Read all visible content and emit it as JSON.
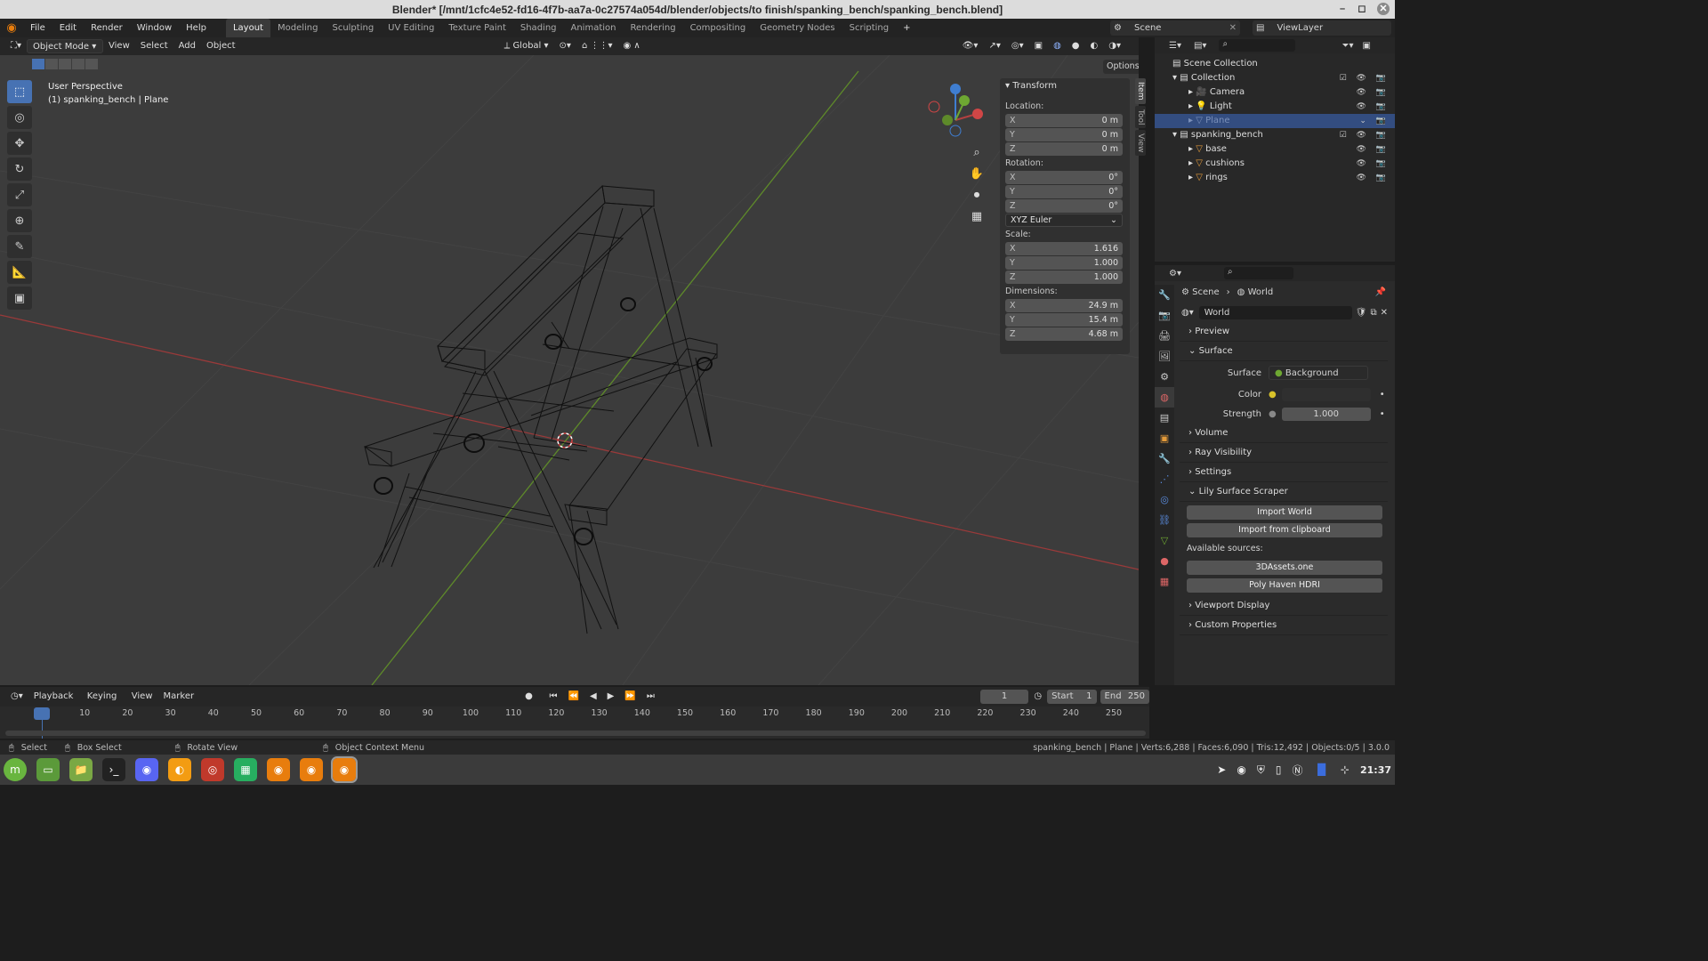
{
  "window": {
    "title": "Blender* [/mnt/1cfc4e52-fd16-4f7b-aa7a-0c27574a054d/blender/objects/to finish/spanking_bench/spanking_bench.blend]"
  },
  "menus": [
    "File",
    "Edit",
    "Render",
    "Window",
    "Help"
  ],
  "workspaces": [
    "Layout",
    "Modeling",
    "Sculpting",
    "UV Editing",
    "Texture Paint",
    "Shading",
    "Animation",
    "Rendering",
    "Compositing",
    "Geometry Nodes",
    "Scripting"
  ],
  "scene": {
    "name": "Scene",
    "view_layer": "ViewLayer"
  },
  "header3d": {
    "mode": "Object Mode",
    "view": "View",
    "select": "Select",
    "add": "Add",
    "object": "Object",
    "orientation": "Global",
    "options": "Options"
  },
  "viewport": {
    "perspective": "User Perspective",
    "selection": "(1) spanking_bench | Plane"
  },
  "npanel": {
    "section": "Transform",
    "location_label": "Location:",
    "location": {
      "x": "0 m",
      "y": "0 m",
      "z": "0 m"
    },
    "rotation_label": "Rotation:",
    "rotation": {
      "x": "0°",
      "y": "0°",
      "z": "0°"
    },
    "rotation_mode": "XYZ Euler",
    "scale_label": "Scale:",
    "scale": {
      "x": "1.616",
      "y": "1.000",
      "z": "1.000"
    },
    "dimensions_label": "Dimensions:",
    "dimensions": {
      "x": "24.9 m",
      "y": "15.4 m",
      "z": "4.68 m"
    },
    "tabs": [
      "Item",
      "Tool",
      "View"
    ]
  },
  "outliner": {
    "root": "Scene Collection",
    "rows": [
      {
        "label": "Collection"
      },
      {
        "label": "Camera"
      },
      {
        "label": "Light"
      },
      {
        "label": "Plane"
      },
      {
        "label": "spanking_bench"
      },
      {
        "label": "base"
      },
      {
        "label": "cushions"
      },
      {
        "label": "rings"
      }
    ]
  },
  "properties": {
    "breadcrumb_scene": "Scene",
    "breadcrumb_world": "World",
    "world_name": "World",
    "sections": {
      "preview": "Preview",
      "surface": "Surface",
      "volume": "Volume",
      "ray_visibility": "Ray Visibility",
      "settings": "Settings",
      "lily": "Lily Surface Scraper",
      "viewport_display": "Viewport Display",
      "custom_properties": "Custom Properties"
    },
    "surface_label": "Surface",
    "surface_value": "Background",
    "color_label": "Color",
    "strength_label": "Strength",
    "strength_value": "1.000",
    "import_world": "Import World",
    "import_clipboard": "Import from clipboard",
    "available_sources": "Available sources:",
    "source_1": "3DAssets.one",
    "source_2": "Poly Haven HDRI"
  },
  "timeline": {
    "playback": "Playback",
    "keying": "Keying",
    "view": "View",
    "marker": "Marker",
    "current_frame": "1",
    "start_label": "Start",
    "start": "1",
    "end_label": "End",
    "end": "250",
    "ticks": [
      "1",
      "10",
      "20",
      "30",
      "40",
      "50",
      "60",
      "70",
      "80",
      "90",
      "100",
      "110",
      "120",
      "130",
      "140",
      "150",
      "160",
      "170",
      "180",
      "190",
      "200",
      "210",
      "220",
      "230",
      "240",
      "250"
    ]
  },
  "status": {
    "select": "Select",
    "box_select": "Box Select",
    "rotate_view": "Rotate View",
    "context_menu": "Object Context Menu",
    "stats": "spanking_bench | Plane | Verts:6,288 | Faces:6,090 | Tris:12,492 | Objects:0/5 | 3.0.0"
  },
  "taskbar": {
    "clock": "21:37"
  },
  "colors": {
    "accent": "#4772b3",
    "x_axis": "#b34040",
    "y_axis": "#6ea832",
    "z_axis": "#3f7ed1"
  }
}
